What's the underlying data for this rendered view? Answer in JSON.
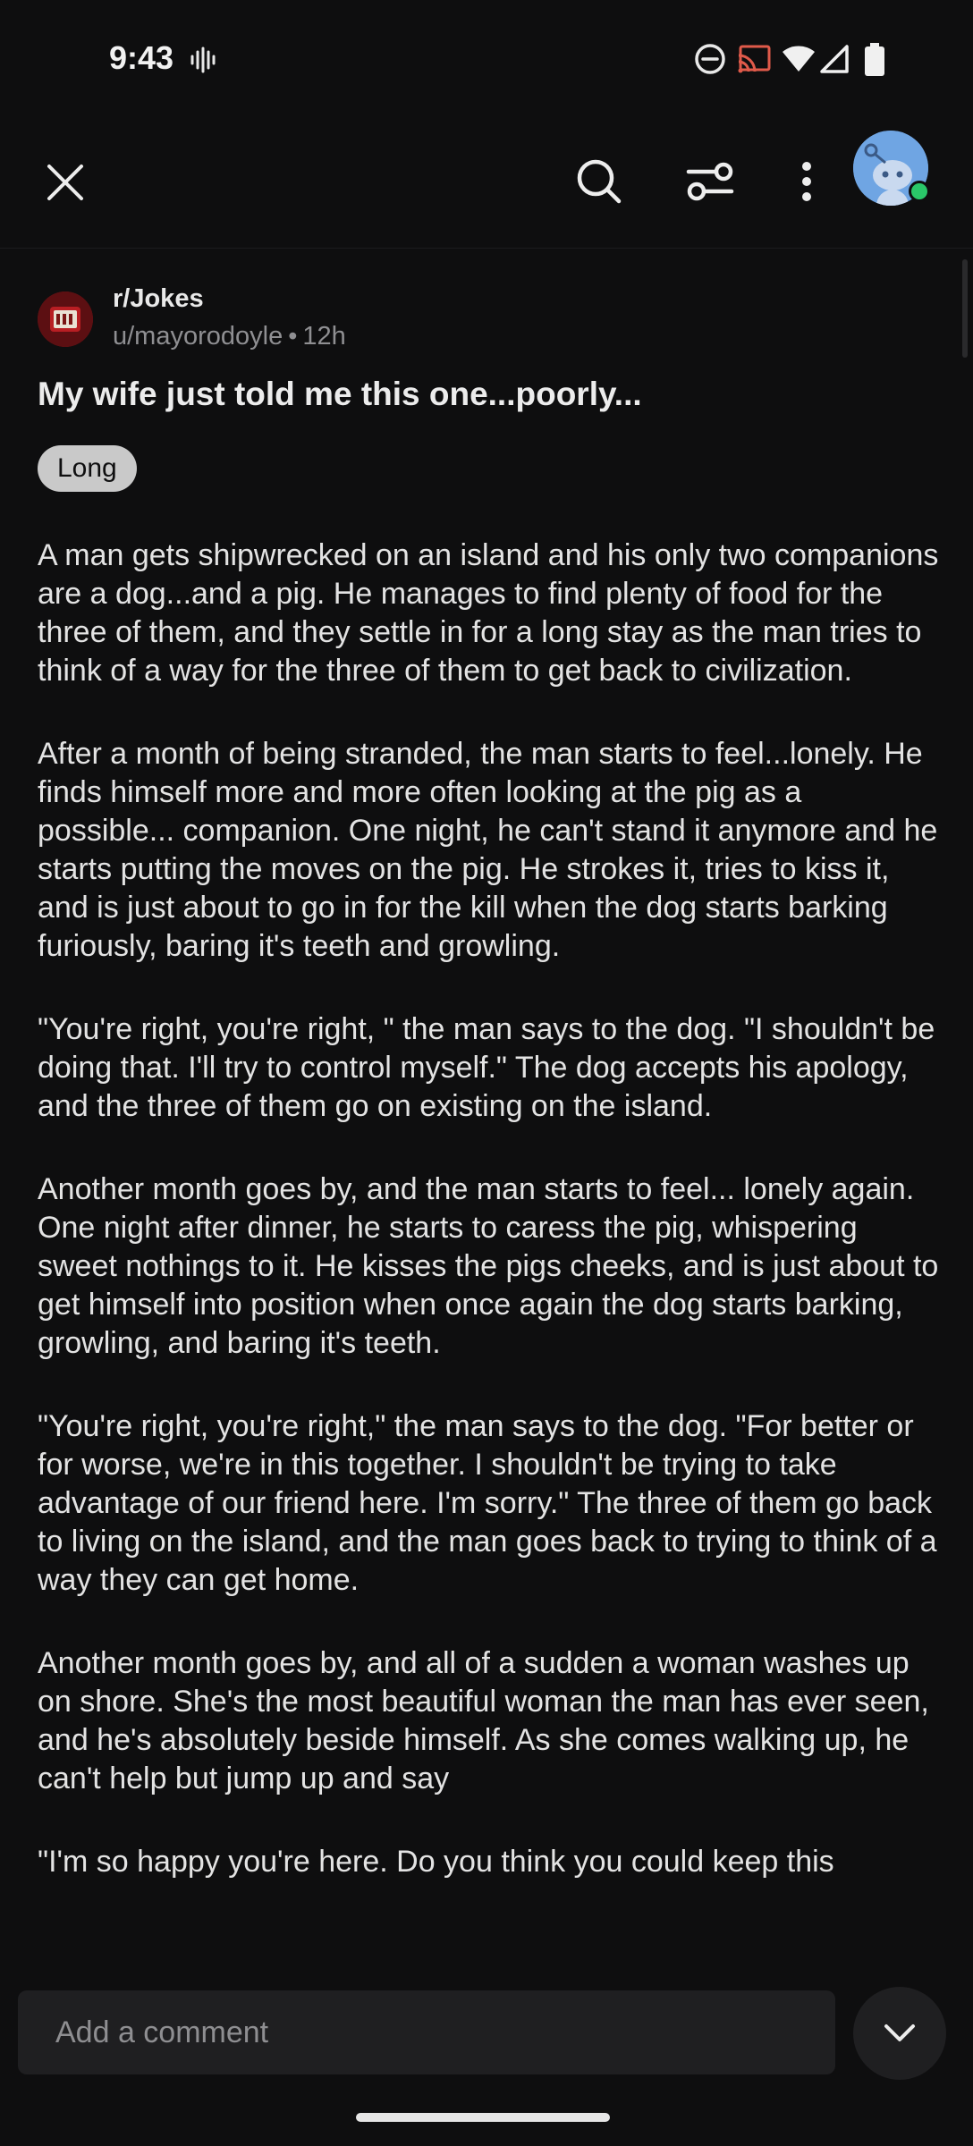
{
  "status_bar": {
    "time": "9:43"
  },
  "icons": {
    "vibrate": "vibrate-icon",
    "dnd": "do-not-disturb-icon",
    "cast": "cast-icon",
    "wifi": "wifi-icon",
    "signal": "signal-icon",
    "battery": "battery-icon",
    "close": "close-icon",
    "search": "search-icon",
    "filter": "filter-icon",
    "more": "more-vert-icon",
    "chevron": "chevron-down-icon"
  },
  "post": {
    "subreddit": "r/Jokes",
    "author": "u/mayorodoyle",
    "separator": "•",
    "age": "12h",
    "title": "My wife just told me this one...poorly...",
    "flair": "Long",
    "paragraphs": [
      "A man gets shipwrecked on an island and his only two companions are a dog...and a pig. He manages to find plenty of food for the three of them, and they settle in for a long stay as the man tries to think of a way for the three of them to get back to civilization.",
      "After a month of being stranded, the man starts to feel...lonely. He finds himself more and more often looking at the pig as a possible... companion. One night, he can't stand it anymore and he starts putting the moves on the pig. He strokes it, tries to kiss it, and is just about to go in for the kill when the dog starts barking furiously, baring it's teeth and growling.",
      "\"You're right, you're right, \" the man says to the dog. \"I shouldn't be doing that. I'll try to control myself.\" The dog accepts his apology, and the three of them go on existing on the island.",
      "Another month goes by, and the man starts to feel... lonely again. One night after dinner, he starts to caress the pig, whispering sweet nothings to it. He kisses the pigs cheeks, and is just about to get himself into position when once again the dog starts barking, growling, and baring it's teeth.",
      "\"You're right, you're right,\" the man says to the dog. \"For better or for worse, we're in this together. I shouldn't be trying to take advantage of our friend here. I'm sorry.\" The three of them go back to living on the island, and the man goes back to trying to think of a way they can get home.",
      "Another month goes by, and all of a sudden a woman washes up on shore. She's the most beautiful woman the man has ever seen, and he's absolutely beside himself. As she comes walking up, he can't help but jump up and say",
      "\"I'm so happy you're here. Do you think you could keep this"
    ]
  },
  "comment": {
    "placeholder": "Add a comment"
  },
  "colors": {
    "background": "#0e0e0f",
    "online": "#2ac769",
    "avatar": "#6fa5e3",
    "flair_bg": "#c9c9c9"
  }
}
